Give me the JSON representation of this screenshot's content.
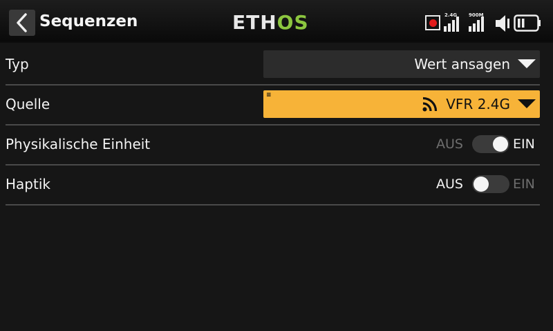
{
  "header": {
    "title": "Sequenzen",
    "logo_left": "ETH",
    "logo_right": "OS",
    "signal1_label": "2.4G",
    "signal2_label": "900M"
  },
  "rows": [
    {
      "label": "Typ",
      "value": "Wert ansagen"
    },
    {
      "label": "Quelle",
      "value": "VFR 2.4G",
      "source_icon": "telemetry-signal-icon"
    },
    {
      "label": "Physikalische Einheit",
      "off_label": "AUS",
      "on_label": "EIN",
      "state": "on"
    },
    {
      "label": "Haptik",
      "off_label": "AUS",
      "on_label": "EIN",
      "state": "off"
    }
  ],
  "colors": {
    "accent": "#f7b338",
    "logo_green": "#8cc63f",
    "record": "#e11b1b"
  }
}
